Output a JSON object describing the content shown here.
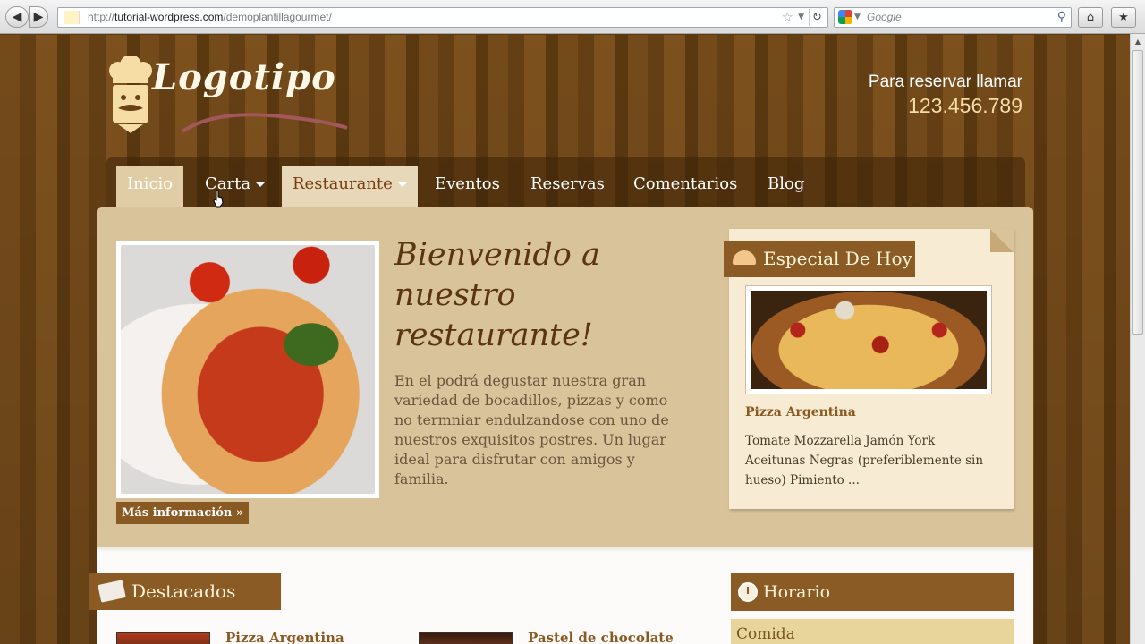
{
  "browser": {
    "url_prefix": "http://",
    "url_domain": "tutorial-wordpress.com",
    "url_path": "/demoplantillagourmet/",
    "search_placeholder": "Google",
    "back_icon": "back-arrow-icon",
    "forward_icon": "forward-arrow-icon",
    "home_icon": "home-icon",
    "bookmarks_icon": "bookmarks-icon"
  },
  "header": {
    "logo_text": "Logotipo",
    "reserve_label": "Para reservar llamar",
    "reserve_phone": "123.456.789"
  },
  "menu": {
    "items": [
      {
        "label": "Inicio"
      },
      {
        "label": "Carta"
      },
      {
        "label": "Restaurante"
      },
      {
        "label": "Eventos"
      },
      {
        "label": "Reservas"
      },
      {
        "label": "Comentarios"
      },
      {
        "label": "Blog"
      }
    ]
  },
  "welcome": {
    "title": "Bienvenido a nuestro restaurante!",
    "text": "En el podrá degustar nuestra gran variedad de bocadillos, pizzas y como no termniar endulzandose con uno de nuestros exquisitos postres. Un lugar ideal para disfrutar con amigos y familia.",
    "more_label": "Más información »"
  },
  "special": {
    "heading": "Especial De Hoy",
    "item_name": "Pizza Argentina",
    "item_desc": "Tomate Mozzarella Jamón York Aceitunas Negras (preferiblemente sin hueso) Pimiento ..."
  },
  "featured": {
    "heading": "Destacados",
    "items": [
      {
        "title": "Pizza Argentina"
      },
      {
        "title": "Pastel de chocolate"
      }
    ]
  },
  "horario": {
    "heading": "Horario",
    "first_row": "Comida"
  },
  "colors": {
    "brown_dark": "#5a3a12",
    "ribbon": "#8b5b25",
    "panel": "#d9c39a"
  }
}
